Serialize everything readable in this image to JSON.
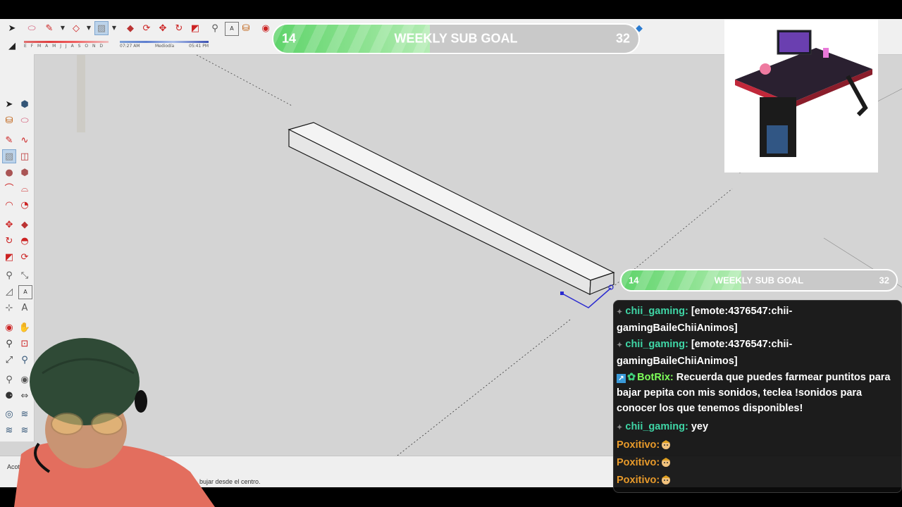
{
  "app": {
    "shadow_strip": {
      "month_letters": "E F M A M J J A S O N D",
      "time_start": "07:27 AM",
      "time_mid": "Mediodía",
      "time_end": "05:41 PM"
    },
    "status_bar": {
      "measure_label": "Acota",
      "hint": "bujar desde el centro."
    }
  },
  "overlay": {
    "goal_top": {
      "current": "14",
      "label": "WEEKLY SUB GOAL",
      "target": "32",
      "progress_fraction": 0.4375
    },
    "goal_side": {
      "current": "14",
      "label": "WEEKLY SUB GOAL",
      "target": "32",
      "progress_fraction": 0.4375
    },
    "chat": {
      "messages": [
        {
          "user": "chii_gaming:",
          "user_color": "#3fd6a6",
          "text": "[emote:4376547:chii-gamingBaileChiiAnimos]"
        },
        {
          "user": "chii_gaming:",
          "user_color": "#3fd6a6",
          "text": "[emote:4376547:chii-gamingBaileChiiAnimos]"
        },
        {
          "user": "BotRix:",
          "user_color": "#7dff5a",
          "text": "Recuerda que puedes farmear puntitos para bajar pepita con mis sonidos, teclea !sonidos para conocer los que tenemos disponibles!"
        },
        {
          "user": "chii_gaming:",
          "user_color": "#3fd6a6",
          "text": "yey"
        },
        {
          "user": "Poxitivo:",
          "user_color": "#e89a2a",
          "text": ""
        },
        {
          "user": "Poxitivo:",
          "user_color": "#e89a2a",
          "text": ""
        },
        {
          "user": "Poxitivo:",
          "user_color": "#e89a2a",
          "text": ""
        }
      ]
    }
  },
  "colors": {
    "goal_fill": "#5fd46b",
    "goal_track": "#c9c9c9",
    "chat_bg": "#0c0c0c",
    "viewport_bg": "#d4d4d4",
    "selection_edge": "#2a2ad0"
  },
  "icons": [
    "select-icon",
    "eraser-icon",
    "pencil-icon",
    "shape-icon",
    "rectangle-icon",
    "push-pull-icon",
    "move-icon",
    "rotate-icon",
    "scale-icon",
    "tape-measure-icon",
    "text-icon",
    "paint-bucket-icon",
    "orbit-icon",
    "pan-icon",
    "zoom-icon",
    "zoom-extents-icon",
    "walk-icon",
    "look-around-icon",
    "section-plane-icon"
  ]
}
